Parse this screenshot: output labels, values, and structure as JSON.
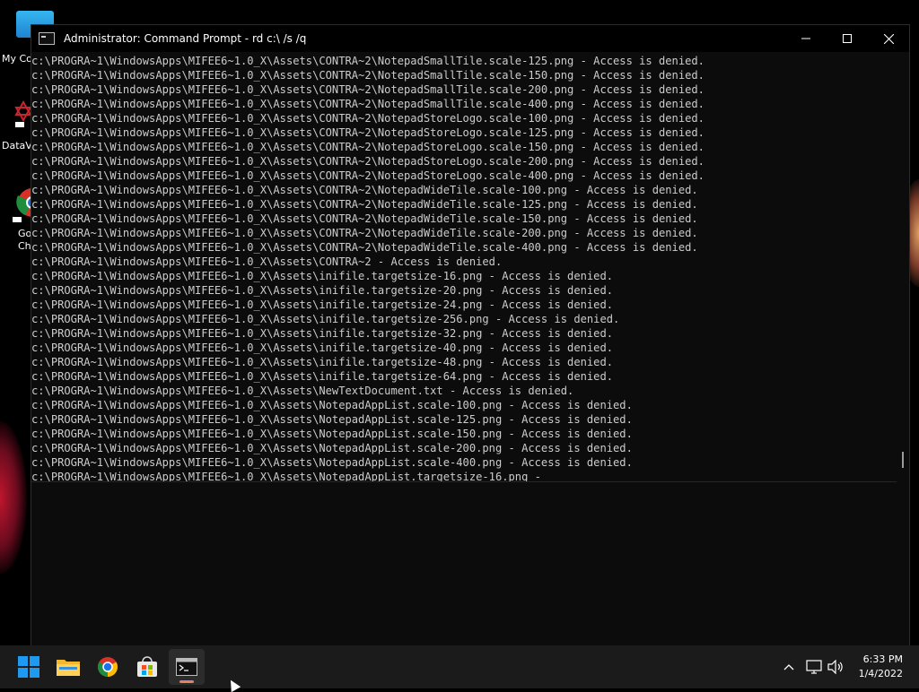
{
  "desktop": {
    "icons": [
      {
        "label": "My Co",
        "icon": "computer-icon"
      },
      {
        "label": "DataV",
        "icon": "datav-shortcut-icon"
      },
      {
        "label": "Go\nCh",
        "icon": "chrome-shortcut-icon"
      }
    ]
  },
  "window": {
    "title": "Administrator: Command Prompt - rd  c:\\ /s /q",
    "controls": {
      "minimize": "minimize-icon",
      "maximize": "maximize-icon",
      "close": "close-icon"
    }
  },
  "console_lines": [
    "c:\\PROGRA~1\\WindowsApps\\MIFEE6~1.0_X\\Assets\\CONTRA~2\\NotepadSmallTile.scale-125.png - Access is denied.",
    "c:\\PROGRA~1\\WindowsApps\\MIFEE6~1.0_X\\Assets\\CONTRA~2\\NotepadSmallTile.scale-150.png - Access is denied.",
    "c:\\PROGRA~1\\WindowsApps\\MIFEE6~1.0_X\\Assets\\CONTRA~2\\NotepadSmallTile.scale-200.png - Access is denied.",
    "c:\\PROGRA~1\\WindowsApps\\MIFEE6~1.0_X\\Assets\\CONTRA~2\\NotepadSmallTile.scale-400.png - Access is denied.",
    "c:\\PROGRA~1\\WindowsApps\\MIFEE6~1.0_X\\Assets\\CONTRA~2\\NotepadStoreLogo.scale-100.png - Access is denied.",
    "c:\\PROGRA~1\\WindowsApps\\MIFEE6~1.0_X\\Assets\\CONTRA~2\\NotepadStoreLogo.scale-125.png - Access is denied.",
    "c:\\PROGRA~1\\WindowsApps\\MIFEE6~1.0_X\\Assets\\CONTRA~2\\NotepadStoreLogo.scale-150.png - Access is denied.",
    "c:\\PROGRA~1\\WindowsApps\\MIFEE6~1.0_X\\Assets\\CONTRA~2\\NotepadStoreLogo.scale-200.png - Access is denied.",
    "c:\\PROGRA~1\\WindowsApps\\MIFEE6~1.0_X\\Assets\\CONTRA~2\\NotepadStoreLogo.scale-400.png - Access is denied.",
    "c:\\PROGRA~1\\WindowsApps\\MIFEE6~1.0_X\\Assets\\CONTRA~2\\NotepadWideTile.scale-100.png - Access is denied.",
    "c:\\PROGRA~1\\WindowsApps\\MIFEE6~1.0_X\\Assets\\CONTRA~2\\NotepadWideTile.scale-125.png - Access is denied.",
    "c:\\PROGRA~1\\WindowsApps\\MIFEE6~1.0_X\\Assets\\CONTRA~2\\NotepadWideTile.scale-150.png - Access is denied.",
    "c:\\PROGRA~1\\WindowsApps\\MIFEE6~1.0_X\\Assets\\CONTRA~2\\NotepadWideTile.scale-200.png - Access is denied.",
    "c:\\PROGRA~1\\WindowsApps\\MIFEE6~1.0_X\\Assets\\CONTRA~2\\NotepadWideTile.scale-400.png - Access is denied.",
    "c:\\PROGRA~1\\WindowsApps\\MIFEE6~1.0_X\\Assets\\CONTRA~2 - Access is denied.",
    "c:\\PROGRA~1\\WindowsApps\\MIFEE6~1.0_X\\Assets\\inifile.targetsize-16.png - Access is denied.",
    "c:\\PROGRA~1\\WindowsApps\\MIFEE6~1.0_X\\Assets\\inifile.targetsize-20.png - Access is denied.",
    "c:\\PROGRA~1\\WindowsApps\\MIFEE6~1.0_X\\Assets\\inifile.targetsize-24.png - Access is denied.",
    "c:\\PROGRA~1\\WindowsApps\\MIFEE6~1.0_X\\Assets\\inifile.targetsize-256.png - Access is denied.",
    "c:\\PROGRA~1\\WindowsApps\\MIFEE6~1.0_X\\Assets\\inifile.targetsize-32.png - Access is denied.",
    "c:\\PROGRA~1\\WindowsApps\\MIFEE6~1.0_X\\Assets\\inifile.targetsize-40.png - Access is denied.",
    "c:\\PROGRA~1\\WindowsApps\\MIFEE6~1.0_X\\Assets\\inifile.targetsize-48.png - Access is denied.",
    "c:\\PROGRA~1\\WindowsApps\\MIFEE6~1.0_X\\Assets\\inifile.targetsize-64.png - Access is denied.",
    "c:\\PROGRA~1\\WindowsApps\\MIFEE6~1.0_X\\Assets\\NewTextDocument.txt - Access is denied.",
    "c:\\PROGRA~1\\WindowsApps\\MIFEE6~1.0_X\\Assets\\NotepadAppList.scale-100.png - Access is denied.",
    "c:\\PROGRA~1\\WindowsApps\\MIFEE6~1.0_X\\Assets\\NotepadAppList.scale-125.png - Access is denied.",
    "c:\\PROGRA~1\\WindowsApps\\MIFEE6~1.0_X\\Assets\\NotepadAppList.scale-150.png - Access is denied.",
    "c:\\PROGRA~1\\WindowsApps\\MIFEE6~1.0_X\\Assets\\NotepadAppList.scale-200.png - Access is denied.",
    "c:\\PROGRA~1\\WindowsApps\\MIFEE6~1.0_X\\Assets\\NotepadAppList.scale-400.png - Access is denied.",
    "c:\\PROGRA~1\\WindowsApps\\MIFEE6~1.0_X\\Assets\\NotepadAppList.targetsize-16.png -"
  ],
  "taskbar": {
    "apps": [
      {
        "name": "start-button",
        "icon": "windows-logo-icon"
      },
      {
        "name": "file-explorer-button",
        "icon": "folder-icon"
      },
      {
        "name": "chrome-button",
        "icon": "chrome-icon"
      },
      {
        "name": "store-button",
        "icon": "store-icon"
      },
      {
        "name": "terminal-button",
        "icon": "terminal-icon",
        "active": true
      }
    ],
    "tray": {
      "chevron": "chevron-up-icon",
      "network": "network-icon",
      "volume": "volume-icon"
    },
    "clock": {
      "time": "6:33 PM",
      "date": "1/4/2022"
    }
  },
  "colors": {
    "console_bg": "#0c0c0c",
    "console_text": "#cccccc",
    "taskbar_bg": "#1b1b1b",
    "active_indicator": "#e58066"
  }
}
